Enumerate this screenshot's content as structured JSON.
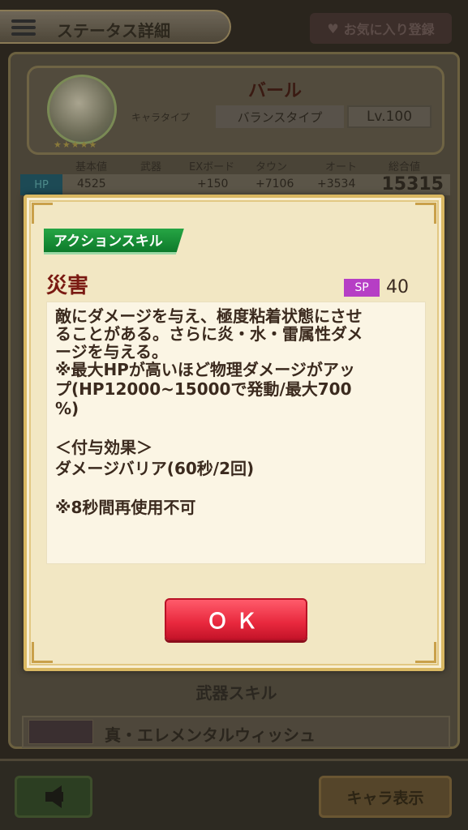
{
  "header": {
    "title": "ステータス詳細",
    "favorite_label": "お気に入り登録"
  },
  "character": {
    "name": "バール",
    "chara_type_label": "キャラタイプ",
    "chara_type_value": "バランスタイプ",
    "level": "Lv.100",
    "stars": "★★★★★"
  },
  "stats": {
    "headers": [
      "基本値",
      "武器",
      "EXボード",
      "タウン",
      "オート",
      "総合値"
    ],
    "hp_label": "HP",
    "hp": {
      "base": "4525",
      "ex_board": "+150",
      "town": "+7106",
      "auto": "+3534",
      "total": "15315"
    }
  },
  "weapon_skill": {
    "header": "武器スキル",
    "name": "真・エレメンタルウィッシュ"
  },
  "footer": {
    "chara_view_label": "キャラ表示"
  },
  "modal": {
    "skill_type": "アクションスキル",
    "skill_name": "災害",
    "sp_label": "SP",
    "sp_value": "40",
    "description_lines": [
      "敵にダメージを与え、極度粘着状態にさせ",
      "ることがある。さらに炎・水・雷属性ダメ",
      "ージを与える。",
      "※最大HPが高いほど物理ダメージがアッ",
      "プ(HP12000~15000で発動/最大700",
      "%)",
      "＜付与効果＞",
      "ダメージバリア(60秒/2回)",
      "※8秒間再使用不可"
    ],
    "ok_label": "ＯＫ"
  },
  "colors": {
    "modal_bg": "#f2e7c3",
    "skill_type_green": "#0d7a2b",
    "skill_name_red": "#7a1a12",
    "sp_purple": "#b63ec5",
    "ok_red": "#e8283d"
  }
}
